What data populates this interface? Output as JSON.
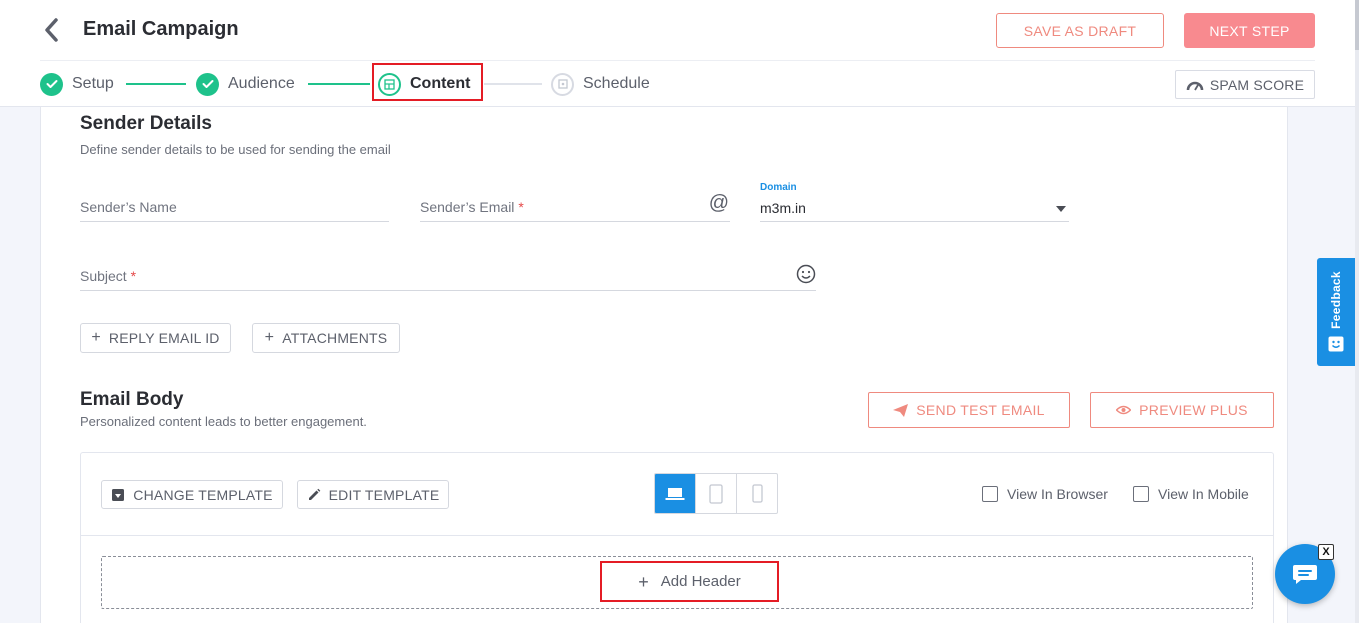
{
  "header": {
    "title": "Email Campaign",
    "save_draft_label": "SAVE AS DRAFT",
    "next_step_label": "NEXT STEP",
    "spam_score_label": "SPAM SCORE"
  },
  "steps": [
    {
      "label": "Setup",
      "status": "done"
    },
    {
      "label": "Audience",
      "status": "done"
    },
    {
      "label": "Content",
      "status": "active"
    },
    {
      "label": "Schedule",
      "status": "pending"
    }
  ],
  "sender": {
    "title": "Sender Details",
    "subtitle": "Define sender details to be used for sending the email",
    "name_label": "Sender’s Name",
    "email_label": "Sender’s Email",
    "domain_label": "Domain",
    "domain_value": "m3m.in",
    "subject_label": "Subject",
    "required_mark": "*",
    "reply_email_label": "REPLY EMAIL ID",
    "attachments_label": "ATTACHMENTS"
  },
  "email_body": {
    "title": "Email Body",
    "subtitle": "Personalized content leads to better engagement.",
    "send_test_label": "SEND TEST EMAIL",
    "preview_plus_label": "PREVIEW PLUS",
    "change_template_label": "CHANGE TEMPLATE",
    "edit_template_label": "EDIT TEMPLATE",
    "view_in_browser_label": "View In Browser",
    "view_in_mobile_label": "View In Mobile",
    "add_header_label": "Add Header"
  },
  "widgets": {
    "feedback_label": "Feedback",
    "chat_close_label": "X"
  },
  "colors": {
    "accent_blue": "#1a8fe3",
    "success_green": "#1ec28b",
    "coral": "#ef8a7f",
    "next_button": "#f88a8f",
    "highlight_red": "#e41c25"
  }
}
